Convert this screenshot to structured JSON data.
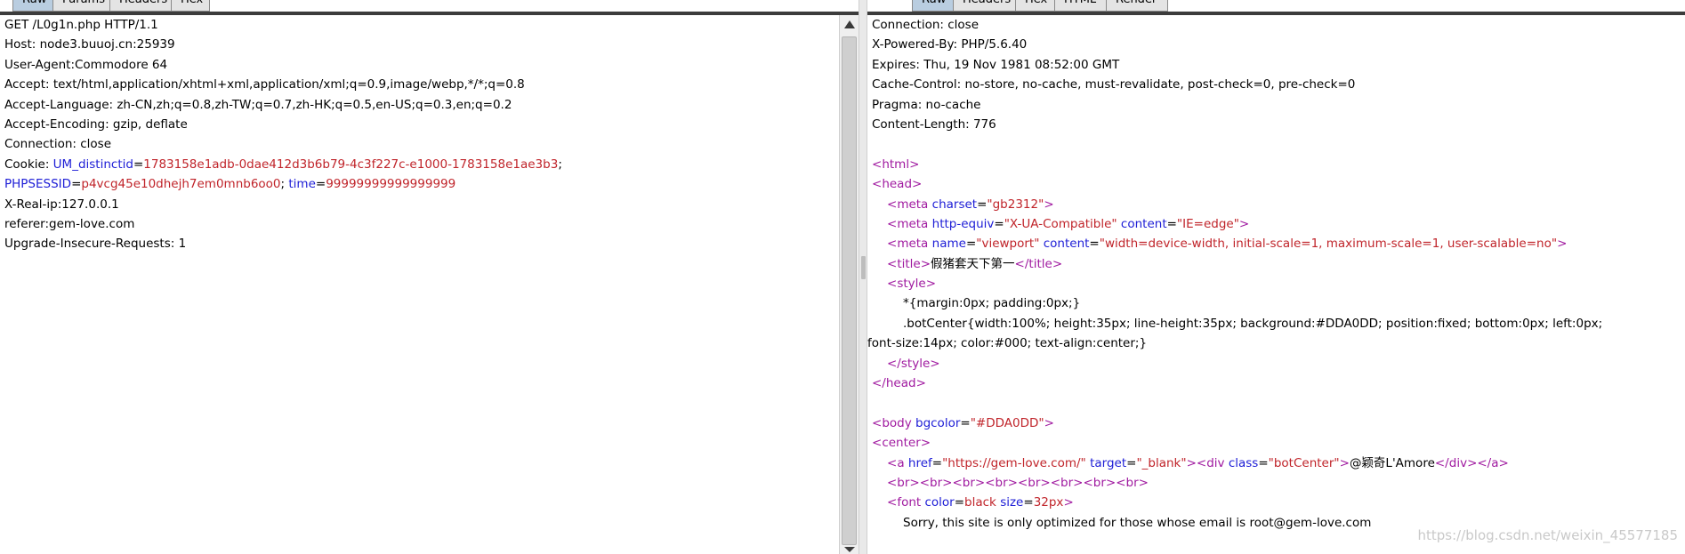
{
  "request_pane": {
    "tabs": [
      "Raw",
      "Params",
      "Headers",
      "Hex"
    ],
    "lines": {
      "request_line": "GET /L0g1n.php HTTP/1.1",
      "host": "Host: node3.buuoj.cn:25939",
      "user_agent": "User-Agent:Commodore 64",
      "accept": "Accept: text/html,application/xhtml+xml,application/xml;q=0.9,image/webp,*/*;q=0.8",
      "accept_language": "Accept-Language: zh-CN,zh;q=0.8,zh-TW;q=0.7,zh-HK;q=0.5,en-US;q=0.3,en;q=0.2",
      "accept_encoding": "Accept-Encoding: gzip, deflate",
      "connection": "Connection: close",
      "x_real_ip": "X-Real-ip:127.0.0.1",
      "referer": "referer:gem-love.com",
      "upgrade": "Upgrade-Insecure-Requests: 1"
    },
    "cookie": {
      "prefix": "Cookie: ",
      "um_key": "UM_distinctid",
      "eq": "=",
      "um_value": "1783158e1adb-0dae412d3b6b79-4c3f227c-e1000-1783158e1ae3b3",
      "semi": "; ",
      "sess_key": "PHPSESSID",
      "sess_value": "p4vcg45e10dhejh7em0mnb6oo0",
      "time_key": "time",
      "time_value": "99999999999999999"
    }
  },
  "response_pane": {
    "tabs": [
      "Raw",
      "Headers",
      "Hex",
      "HTML",
      "Render"
    ],
    "headers": {
      "connection": "Connection: close",
      "powered_by": "X-Powered-By: PHP/5.6.40",
      "expires": "Expires: Thu, 19 Nov 1981 08:52:00 GMT",
      "cache_control": "Cache-Control: no-store, no-cache, must-revalidate, post-check=0, pre-check=0",
      "pragma": "Pragma: no-cache",
      "content_length": "Content-Length: 776"
    },
    "html": {
      "lt": "<",
      "gt": ">",
      "close_lt": "</",
      "sp": " ",
      "eq": "=",
      "html_tag": "html",
      "head_tag": "head",
      "meta_tag": "meta",
      "title_tag": "title",
      "style_tag": "style",
      "body_tag": "body",
      "center_tag": "center",
      "a_tag": "a",
      "div_tag": "div",
      "font_tag": "font",
      "br_tags": "<br><br><br><br><br><br><br><br>",
      "charset_attr": "charset",
      "charset_val": "\"gb2312\"",
      "http_equiv_attr": "http-equiv",
      "http_equiv_val": "\"X-UA-Compatible\"",
      "content_attr": "content",
      "content_val_1": "\"IE=edge\"",
      "name_attr": "name",
      "name_val": "\"viewport\"",
      "content_val_2": "\"width=device-width, initial-scale=1, maximum-scale=1, user-scalable=no\"",
      "title_text": "假猪套天下第一",
      "style_line_1": "*{margin:0px; padding:0px;}",
      "style_line_2": ".botCenter{width:100%; height:35px; line-height:35px; background:#DDA0DD; position:fixed; bottom:0px; left:0px;",
      "style_line_3": "font-size:14px; color:#000; text-align:center;}",
      "bgcolor_attr": "bgcolor",
      "bgcolor_val": "\"#DDA0DD\"",
      "href_attr": "href",
      "href_val": "\"https://gem-love.com/\"",
      "target_attr": "target",
      "target_val": "\"_blank\"",
      "class_attr": "class",
      "class_val": "\"botCenter\"",
      "link_text": "@颖奇L'Amore",
      "color_attr": "color",
      "color_val": "black",
      "size_attr": "size",
      "size_val": "32px",
      "sorry_text": "Sorry, this site is only optimized for those whose email is root@gem-love.com"
    }
  },
  "watermark": "https://blog.csdn.net/weixin_45577185",
  "colors": {
    "header_name": "#1d1dd6",
    "header_value": "#c0242a",
    "tag": "#a01aa0",
    "attribute": "#1d1dd6",
    "string": "#c0242a",
    "active_tab": "#b9cde0"
  }
}
